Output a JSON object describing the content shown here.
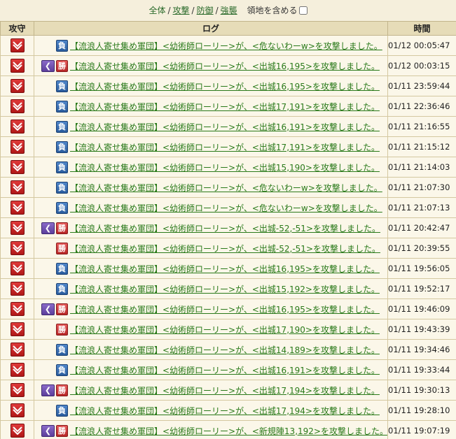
{
  "filter": {
    "all": "全体",
    "attack": "攻撃",
    "defense": "防御",
    "raid": "強襲",
    "include_territory": "領地を含める",
    "sep": "/"
  },
  "table": {
    "headers": {
      "type": "攻守",
      "log": "ログ",
      "time": "時間"
    },
    "rows": [
      {
        "badges": [
          "lose"
        ],
        "text": "【流浪人寄せ集め軍団】<幼術師ローリー>が、<危ないわーw>を攻撃しました。",
        "time": "01/12 00:05:47"
      },
      {
        "badges": [
          "special",
          "win"
        ],
        "text": "【流浪人寄せ集め軍団】<幼術師ローリー>が、<出城16,195>を攻撃しました。",
        "time": "01/12 00:03:15"
      },
      {
        "badges": [
          "lose"
        ],
        "text": "【流浪人寄せ集め軍団】<幼術師ローリー>が、<出城16,195>を攻撃しました。",
        "time": "01/11 23:59:44"
      },
      {
        "badges": [
          "lose"
        ],
        "text": "【流浪人寄せ集め軍団】<幼術師ローリー>が、<出城17,191>を攻撃しました。",
        "time": "01/11 22:36:46"
      },
      {
        "badges": [
          "lose"
        ],
        "text": "【流浪人寄せ集め軍団】<幼術師ローリー>が、<出城16,191>を攻撃しました。",
        "time": "01/11 21:16:55"
      },
      {
        "badges": [
          "lose"
        ],
        "text": "【流浪人寄せ集め軍団】<幼術師ローリー>が、<出城17,191>を攻撃しました。",
        "time": "01/11 21:15:12"
      },
      {
        "badges": [
          "lose"
        ],
        "text": "【流浪人寄せ集め軍団】<幼術師ローリー>が、<出城15,190>を攻撃しました。",
        "time": "01/11 21:14:03"
      },
      {
        "badges": [
          "lose"
        ],
        "text": "【流浪人寄せ集め軍団】<幼術師ローリー>が、<危ないわーw>を攻撃しました。",
        "time": "01/11 21:07:30"
      },
      {
        "badges": [
          "lose"
        ],
        "text": "【流浪人寄せ集め軍団】<幼術師ローリー>が、<危ないわーw>を攻撃しました。",
        "time": "01/11 21:07:13"
      },
      {
        "badges": [
          "special",
          "win"
        ],
        "text": "【流浪人寄せ集め軍団】<幼術師ローリー>が、<出城-52,-51>を攻撃しました。",
        "time": "01/11 20:42:47"
      },
      {
        "badges": [
          "win"
        ],
        "text": "【流浪人寄せ集め軍団】<幼術師ローリー>が、<出城-52,-51>を攻撃しました。",
        "time": "01/11 20:39:55"
      },
      {
        "badges": [
          "lose"
        ],
        "text": "【流浪人寄せ集め軍団】<幼術師ローリー>が、<出城16,195>を攻撃しました。",
        "time": "01/11 19:56:05"
      },
      {
        "badges": [
          "lose"
        ],
        "text": "【流浪人寄せ集め軍団】<幼術師ローリー>が、<出城15,192>を攻撃しました。",
        "time": "01/11 19:52:17"
      },
      {
        "badges": [
          "special",
          "win"
        ],
        "text": "【流浪人寄せ集め軍団】<幼術師ローリー>が、<出城16,195>を攻撃しました。",
        "time": "01/11 19:46:09"
      },
      {
        "badges": [
          "win"
        ],
        "text": "【流浪人寄せ集め軍団】<幼術師ローリー>が、<出城17,190>を攻撃しました。",
        "time": "01/11 19:43:39"
      },
      {
        "badges": [
          "lose"
        ],
        "text": "【流浪人寄せ集め軍団】<幼術師ローリー>が、<出城14,189>を攻撃しました。",
        "time": "01/11 19:34:46"
      },
      {
        "badges": [
          "lose"
        ],
        "text": "【流浪人寄せ集め軍団】<幼術師ローリー>が、<出城16,191>を攻撃しました。",
        "time": "01/11 19:33:44"
      },
      {
        "badges": [
          "special",
          "win"
        ],
        "text": "【流浪人寄せ集め軍団】<幼術師ローリー>が、<出城17,194>を攻撃しました。",
        "time": "01/11 19:30:13"
      },
      {
        "badges": [
          "lose"
        ],
        "text": "【流浪人寄せ集め軍団】<幼術師ローリー>が、<出城17,194>を攻撃しました。",
        "time": "01/11 19:28:10"
      },
      {
        "badges": [
          "special",
          "win"
        ],
        "text": "【流浪人寄せ集め軍団】<幼術師ローリー>が、<新規陣13,192>を攻撃しました。",
        "time": "01/11 19:07:19"
      }
    ]
  },
  "badge_labels": {
    "win": "勝",
    "lose": "負",
    "special": "❮"
  },
  "colors": {
    "link": "#2a7a1a",
    "win": "#c23030",
    "lose": "#3a6fb2",
    "special": "#6e52b0",
    "attack_icon": "#c62222"
  }
}
